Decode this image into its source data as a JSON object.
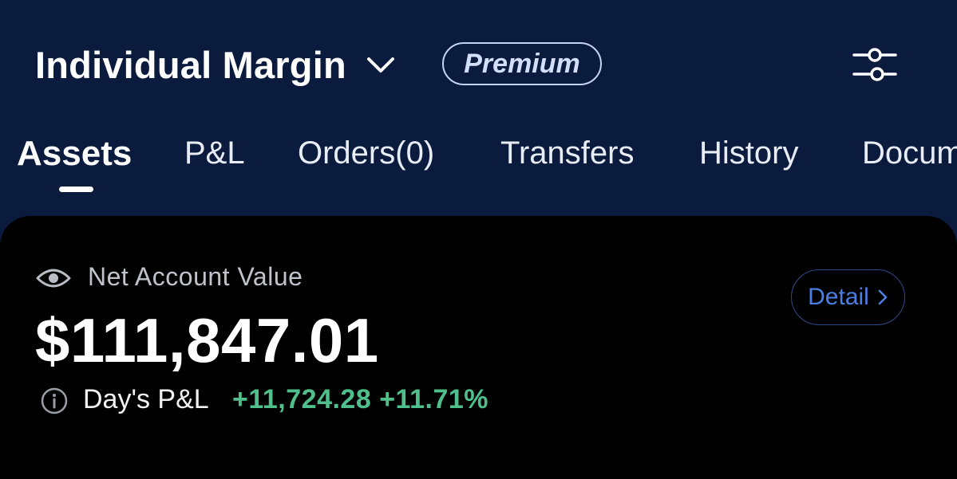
{
  "header": {
    "account_title": "Individual Margin",
    "badge": "Premium"
  },
  "tabs": [
    {
      "label": "Assets",
      "active": true
    },
    {
      "label": "P&L"
    },
    {
      "label": "Orders(0)"
    },
    {
      "label": "Transfers"
    },
    {
      "label": "History"
    },
    {
      "label": "Documents"
    }
  ],
  "summary": {
    "label": "Net Account Value",
    "value": "$111,847.01",
    "detail_label": "Detail",
    "day_pnl_label": "Day's P&L",
    "day_pnl_amount": "+11,724.28",
    "day_pnl_percent": "+11.71%"
  },
  "icons": {
    "dropdown": "chevron-down-icon",
    "settings": "sliders-icon",
    "visibility": "eye-icon",
    "info": "info-icon",
    "detail": "chevron-right-icon"
  },
  "colors": {
    "background": "#0b1b3d",
    "card": "#000000",
    "positive": "#4fc08b",
    "accent": "#4c7fe4"
  }
}
